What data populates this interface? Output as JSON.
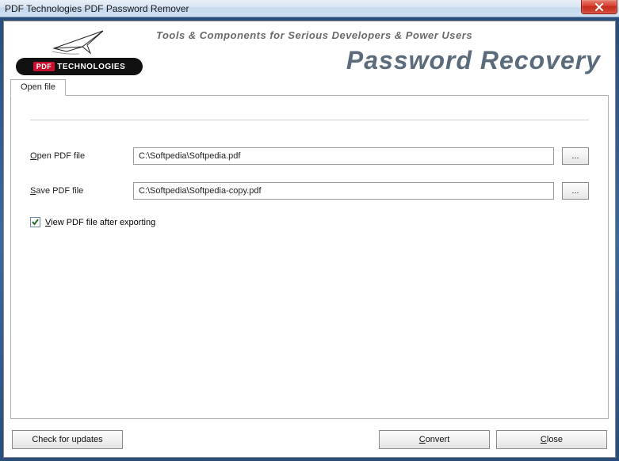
{
  "window": {
    "title": "PDF Technologies PDF Password Remover"
  },
  "header": {
    "brand_prefix": "PDF",
    "brand_suffix": "TECHNOLOGIES",
    "tagline": "Tools & Components for Serious Developers & Power Users",
    "hero": "Password Recovery"
  },
  "tab": {
    "label": "Open file"
  },
  "form": {
    "open_label_pre": "O",
    "open_label_rest": "pen PDF file",
    "open_value": "C:\\Softpedia\\Softpedia.pdf",
    "save_label_pre": "S",
    "save_label_rest": "ave PDF file",
    "save_value": "C:\\Softpedia\\Softpedia-copy.pdf",
    "browse_label": "...",
    "view_checked": true,
    "view_label_pre": "V",
    "view_label_rest": "iew PDF file after exporting"
  },
  "buttons": {
    "updates": "Check for updates",
    "convert_pre": "C",
    "convert_rest": "onvert",
    "close_pre": "C",
    "close_rest": "lose"
  }
}
